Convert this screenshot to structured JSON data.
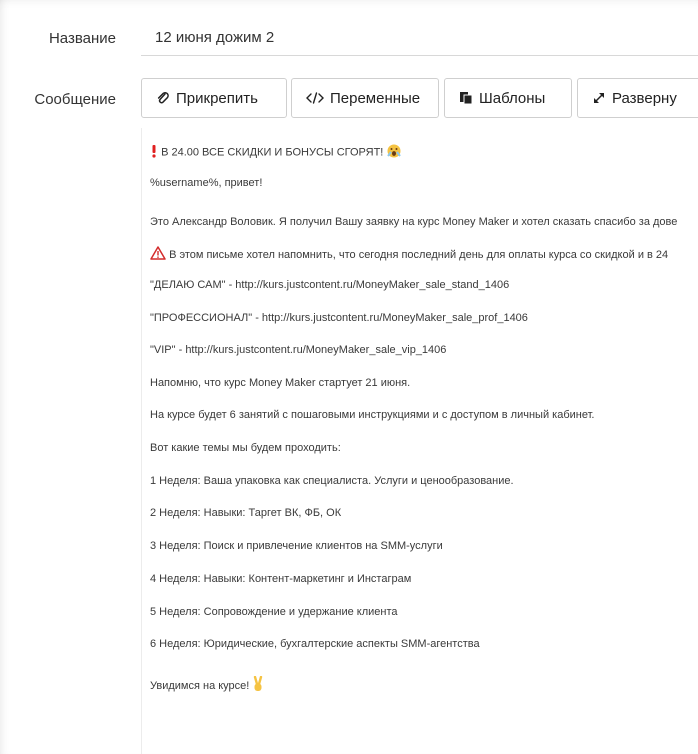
{
  "form": {
    "name_label": "Название",
    "name_value": "12 июня дожим 2",
    "message_label": "Сообщение"
  },
  "toolbar": {
    "attach": {
      "label": "Прикрепить",
      "icon": "paperclip-icon"
    },
    "variables": {
      "label": "Переменные",
      "icon": "code-icon"
    },
    "templates": {
      "label": "Шаблоны",
      "icon": "templates-icon"
    },
    "expand": {
      "label": "Разверну",
      "icon": "expand-icon"
    }
  },
  "message": {
    "lines": [
      "В 24.00 ВСЕ СКИДКИ И БОНУСЫ СГОРЯТ!",
      "%username%, привет!",
      "Это Александр Воловик. Я получил Вашу заявку на курс Money Maker и хотел сказать спасибо за дове",
      "В этом письме хотел напомнить, что сегодня последний день для оплаты курса со скидкой и в 24",
      "\"ДЕЛАЮ САМ\" - http://kurs.justcontent.ru/MoneyMaker_sale_stand_1406",
      "\"ПРОФЕССИОНАЛ\" - http://kurs.justcontent.ru/MoneyMaker_sale_prof_1406",
      "\"VIP\" - http://kurs.justcontent.ru/MoneyMaker_sale_vip_1406",
      "Напомню, что курс Money Maker стартует 21 июня.",
      "На курсе будет 6 занятий с пошаговыми инструкциями и с доступом в личный кабинет.",
      "Вот какие темы мы будем проходить:",
      "1 Неделя: Ваша упаковка как специалиста. Услуги и ценообразование.",
      "2 Неделя: Навыки: Таргет ВК, ФБ, ОК",
      "3 Неделя: Поиск и привлечение клиентов на SMM-услуги",
      "4 Неделя: Навыки: Контент-маркетинг и Инстаграм",
      "5 Неделя: Сопровождение и удержание клиента",
      "6 Неделя: Юридические, бухгалтерские аспекты SMM-агентства",
      "Увидимся на курсе!"
    ]
  },
  "colors": {
    "exclamation": "#e02020",
    "warning": "#d42b2b",
    "emoji_yellow": "#f5c342"
  }
}
